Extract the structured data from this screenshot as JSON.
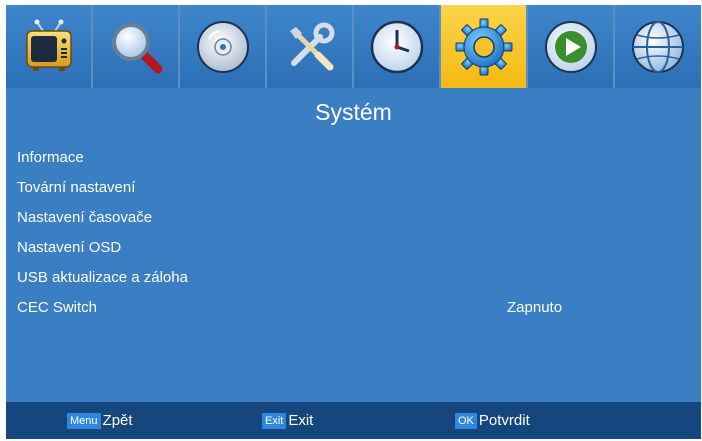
{
  "tabs": [
    {
      "icon": "tv-icon",
      "active": false
    },
    {
      "icon": "search-icon",
      "active": false
    },
    {
      "icon": "disc-icon",
      "active": false
    },
    {
      "icon": "tools-icon",
      "active": false
    },
    {
      "icon": "clock-icon",
      "active": false
    },
    {
      "icon": "gear-icon",
      "active": true
    },
    {
      "icon": "play-icon",
      "active": false
    },
    {
      "icon": "globe-icon",
      "active": false
    }
  ],
  "page_title": "Systém",
  "menu": [
    {
      "label": "Informace",
      "value": ""
    },
    {
      "label": "Tovární nastavení",
      "value": ""
    },
    {
      "label": "Nastavení časovače",
      "value": ""
    },
    {
      "label": "Nastavení OSD",
      "value": ""
    },
    {
      "label": "USB aktualizace a záloha",
      "value": ""
    },
    {
      "label": "CEC Switch",
      "value": "Zapnuto"
    }
  ],
  "footer": {
    "back": {
      "key": "Menu",
      "label": "Zpět"
    },
    "exit": {
      "key": "Exit",
      "label": "Exit"
    },
    "ok": {
      "key": "OK",
      "label": "Potvrdit"
    }
  },
  "colors": {
    "background": "#3a7ec3",
    "tab": "#2f74bb",
    "tab_active": "#f6c12a",
    "footer": "#16467e",
    "key_badge": "#2f86dc"
  }
}
